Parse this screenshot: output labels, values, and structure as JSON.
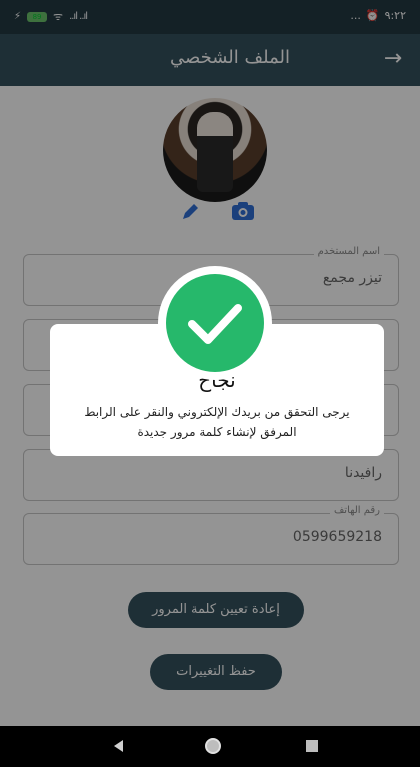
{
  "status_bar": {
    "time": "٩:٢٢",
    "battery": "89",
    "signal": "..ıl ..ıl",
    "dots": "..."
  },
  "app_bar": {
    "title": "الملف الشخصي",
    "back_icon": "arrow-right-icon"
  },
  "profile": {
    "edit_icon": "pencil-icon",
    "camera_icon": "camera-icon"
  },
  "fields": [
    {
      "label": "اسم المستخدم",
      "value": "تيزر مجمع"
    },
    {
      "label": "",
      "value": ""
    },
    {
      "label": "",
      "value": ""
    },
    {
      "label": "",
      "value": "رافيدنا"
    },
    {
      "label": "رقم الهاتف",
      "value": "0599659218"
    }
  ],
  "buttons": {
    "reset_password": "إعادة تعيين كلمة المرور",
    "save_changes": "حفظ التغييرات"
  },
  "dialog": {
    "title": "نجاح",
    "message": "يرجى التحقق من بريدك الإلكتروني والنقر على الرابط المرفق لإنشاء كلمة مرور جديدة",
    "icon": "check-icon",
    "accent": "#26b86b"
  },
  "colors": {
    "primary": "#34515d",
    "status_bar": "#233a43"
  }
}
